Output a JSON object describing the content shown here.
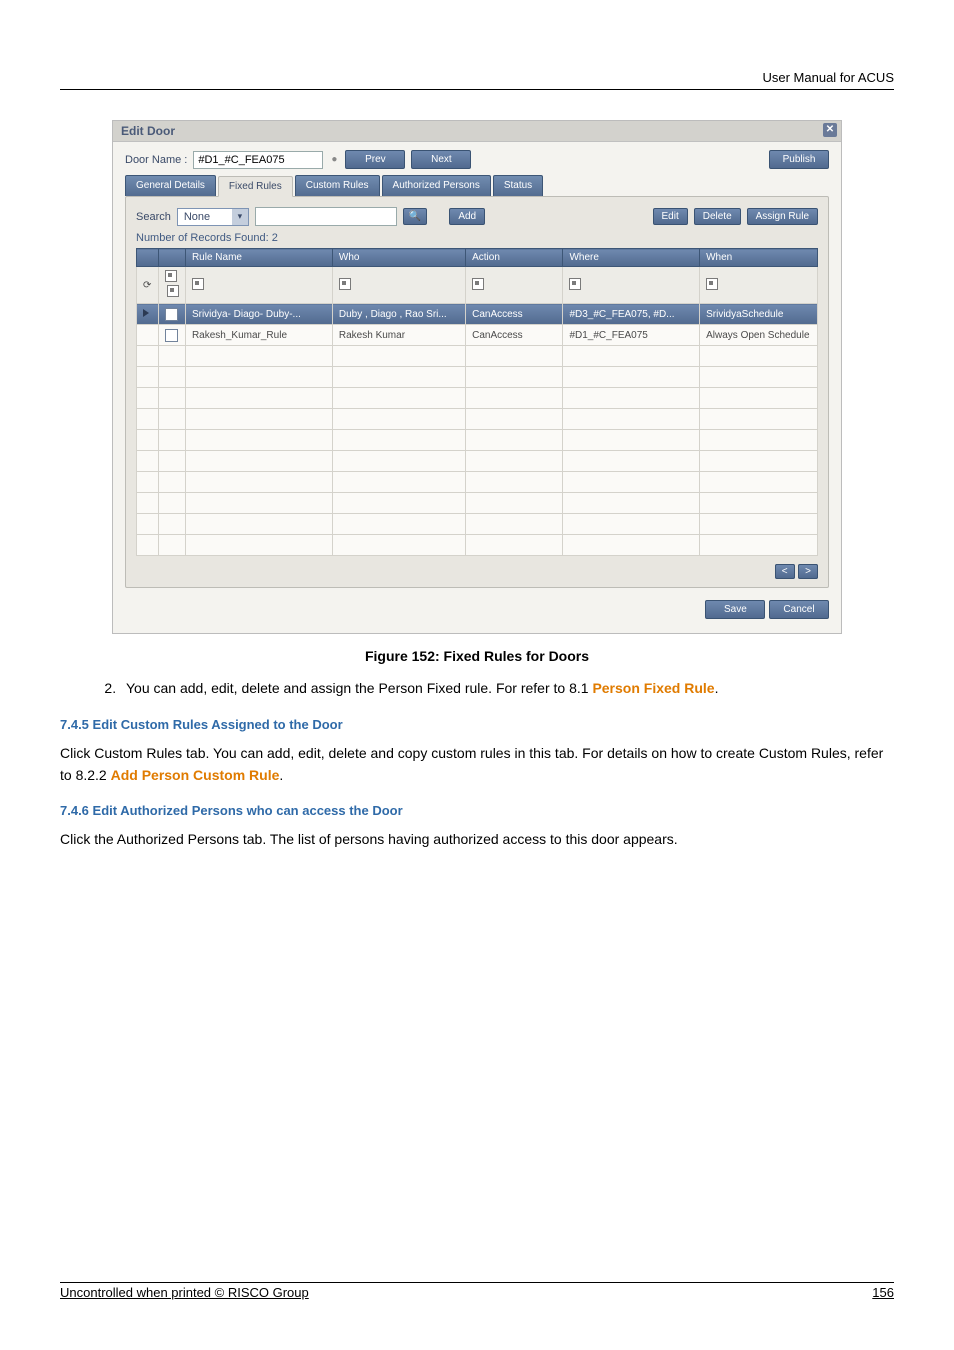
{
  "header": {
    "title": "User Manual for ACUS"
  },
  "app": {
    "window_title": "Edit Door",
    "door_name_label": "Door Name :",
    "door_name_value": "#D1_#C_FEA075",
    "nav": {
      "prev": "Prev",
      "next": "Next",
      "publish": "Publish"
    },
    "tabs": {
      "general": "General Details",
      "fixed": "Fixed Rules",
      "custom": "Custom Rules",
      "persons": "Authorized Persons",
      "status": "Status"
    },
    "search": {
      "label": "Search",
      "field_value": "None",
      "add": "Add",
      "edit": "Edit",
      "delete": "Delete",
      "assign": "Assign Rule"
    },
    "records_found": "Number of Records Found: 2",
    "columns": {
      "rule_name": "Rule Name",
      "who": "Who",
      "action": "Action",
      "where": "Where",
      "when": "When"
    },
    "rows": [
      {
        "selected": true,
        "rule_name": "Srividya- Diago- Duby-...",
        "who": "Duby  , Diago  , Rao Sri...",
        "action": "CanAccess",
        "where": "#D3_#C_FEA075, #D...",
        "when": "SrividyaSchedule"
      },
      {
        "selected": false,
        "rule_name": "Rakesh_Kumar_Rule",
        "who": "Rakesh Kumar",
        "action": "CanAccess",
        "where": "#D1_#C_FEA075",
        "when": "Always Open Schedule"
      }
    ],
    "pager": {
      "prev": "<",
      "next": ">"
    },
    "footer_btns": {
      "save": "Save",
      "cancel": "Cancel"
    }
  },
  "caption": "Figure 152: Fixed Rules for Doors",
  "list_item_prefix": "You can add, edit, delete and assign the Person Fixed rule. For refer to 8.1 ",
  "list_item_link": "Person Fixed Rule",
  "list_item_suffix": ".",
  "section_745": {
    "heading": "7.4.5  Edit Custom Rules Assigned to the Door",
    "para_prefix": "Click Custom Rules tab. You can add, edit, delete and copy custom rules in this tab. For details on how to create Custom Rules, refer to 8.2.2 ",
    "para_link": "Add Person Custom Rule",
    "para_suffix": "."
  },
  "section_746": {
    "heading": "7.4.6  Edit Authorized Persons who can access the Door",
    "para": "Click the Authorized Persons tab. The list of persons having authorized access to this door appears."
  },
  "footer": {
    "left": "Uncontrolled when printed © RISCO Group",
    "right": "156"
  }
}
